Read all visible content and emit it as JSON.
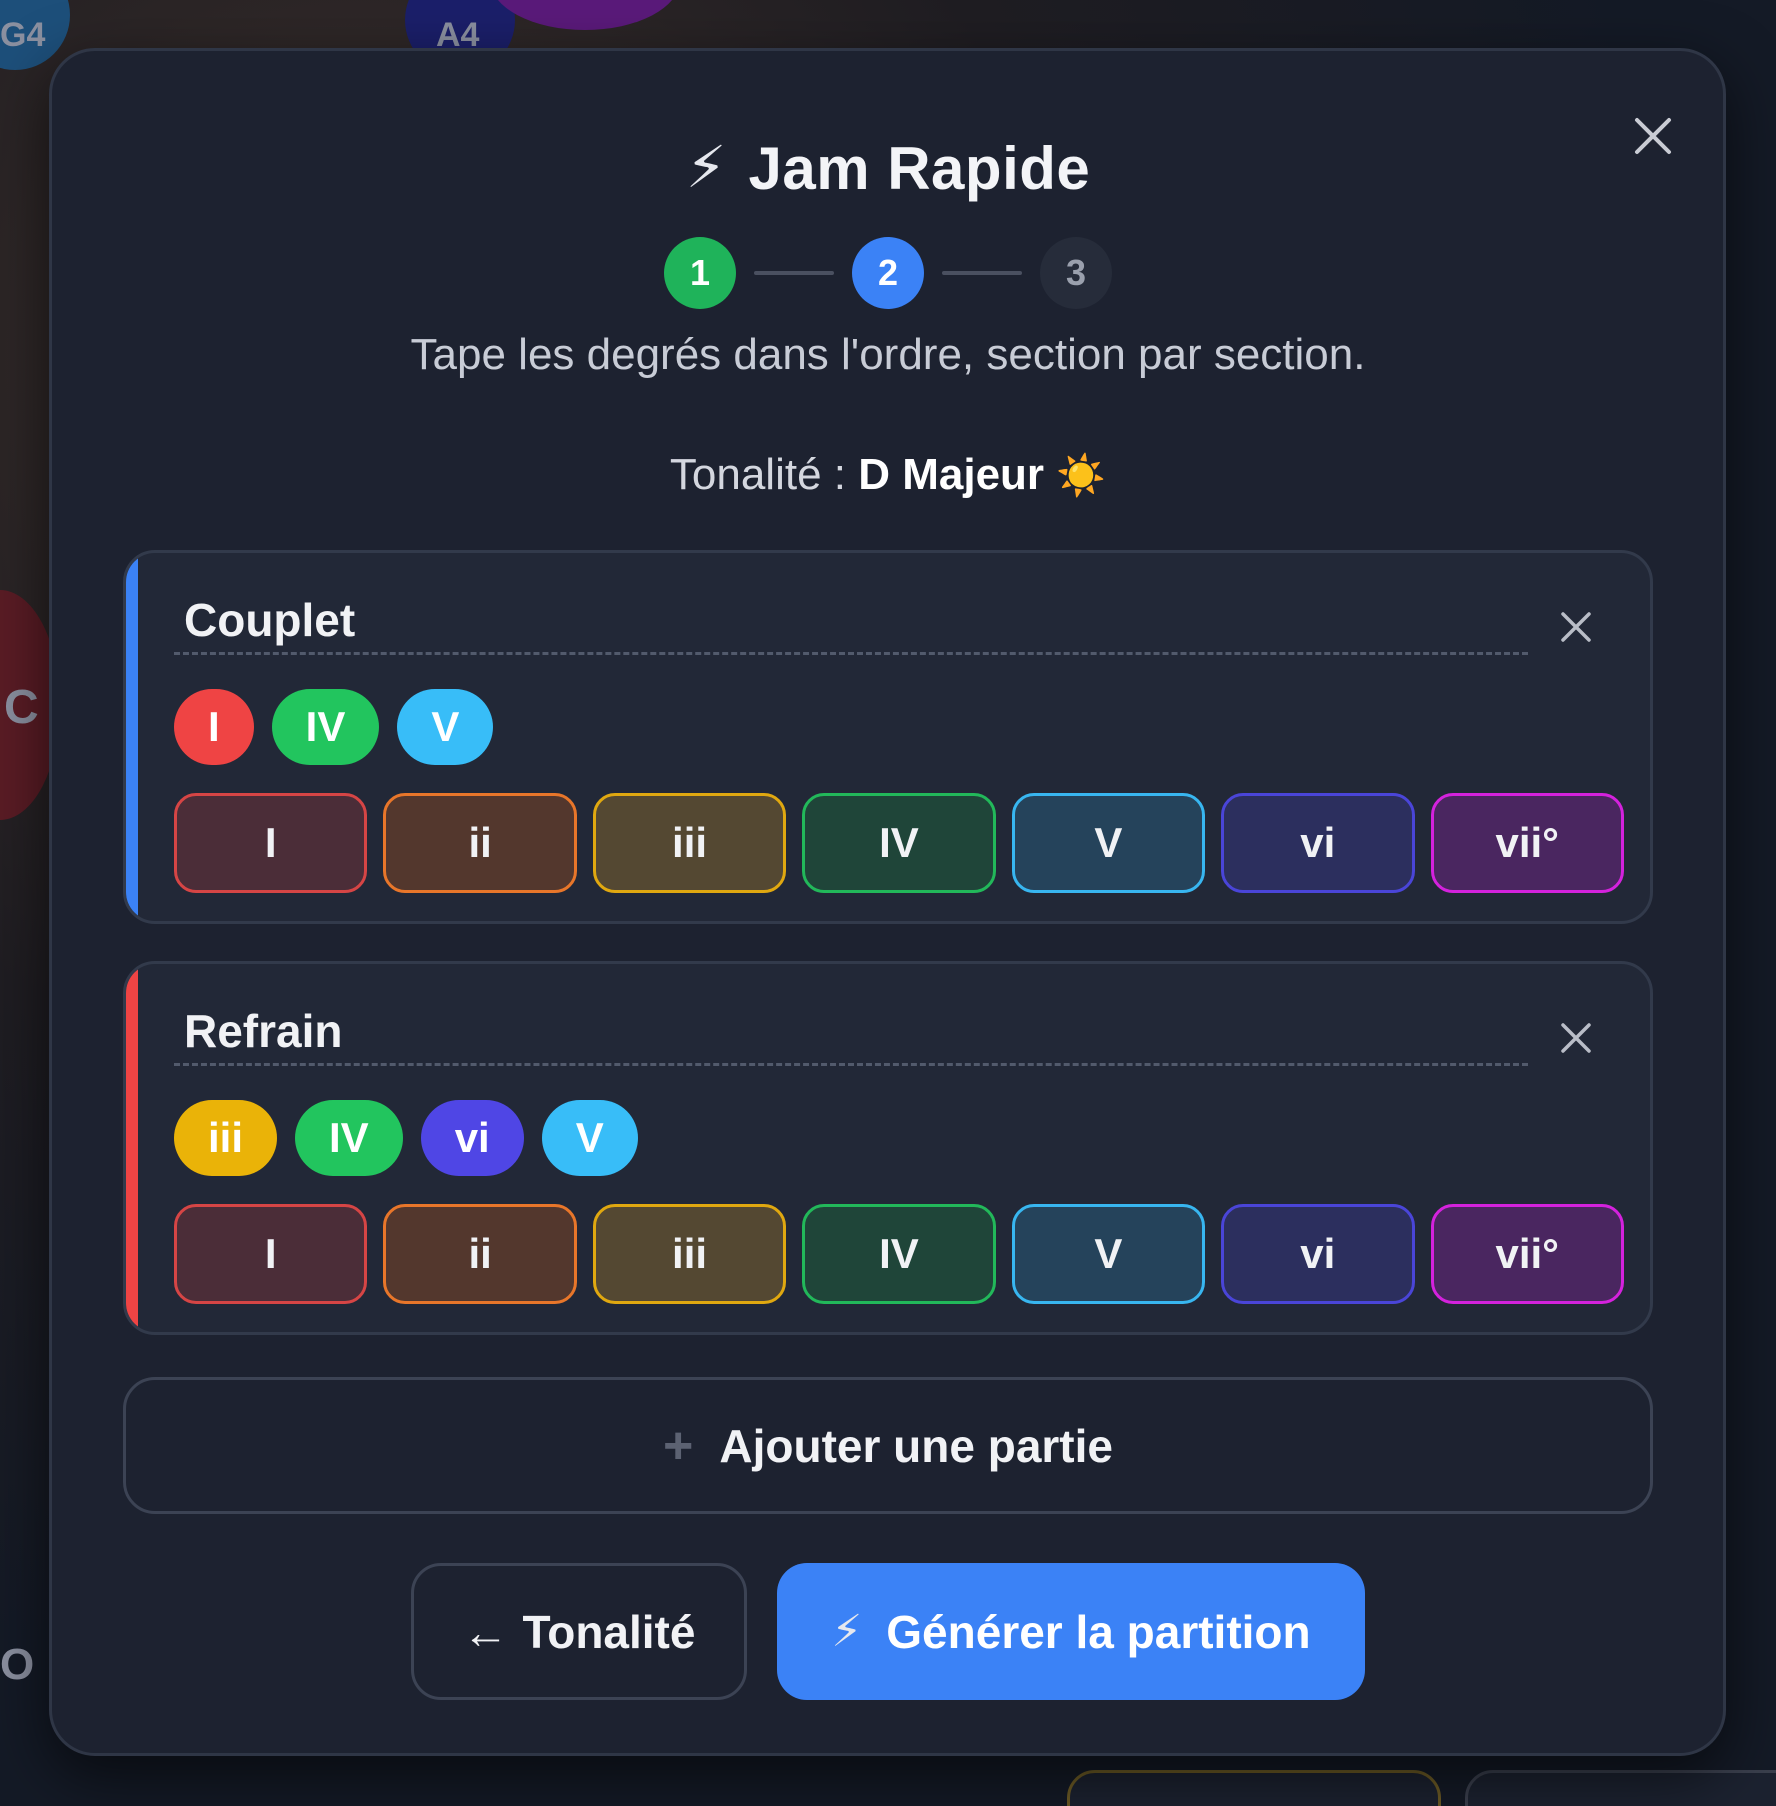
{
  "background": {
    "notes": [
      "G4",
      "A4",
      "C",
      "O"
    ]
  },
  "modal": {
    "title_icon": "⚡",
    "title": "Jam Rapide",
    "steps": [
      {
        "label": "1",
        "state": "done"
      },
      {
        "label": "2",
        "state": "active"
      },
      {
        "label": "3",
        "state": "todo"
      }
    ],
    "subtitle": "Tape les degrés dans l'ordre, section par section.",
    "key_label": "Tonalité : ",
    "key_value": "D Majeur",
    "key_icon": "☀️"
  },
  "degree_buttons": [
    "I",
    "ii",
    "iii",
    "IV",
    "V",
    "vi",
    "vii°"
  ],
  "sections": [
    {
      "title": "Couplet",
      "accent": "#3b82f6",
      "chips": [
        "I",
        "IV",
        "V"
      ]
    },
    {
      "title": "Refrain",
      "accent": "#ef4444",
      "chips": [
        "iii",
        "IV",
        "vi",
        "V"
      ]
    }
  ],
  "colors": {
    "I": {
      "chip": "#ef4444",
      "fill": "#4b2d38",
      "border": "#d64545"
    },
    "ii": {
      "chip": "#f97316",
      "fill": "#53372d",
      "border": "#e8762a"
    },
    "iii": {
      "chip": "#eab308",
      "fill": "#544832",
      "border": "#e0a810"
    },
    "IV": {
      "chip": "#22c55e",
      "fill": "#1f4539",
      "border": "#22b85a"
    },
    "V": {
      "chip": "#38bdf8",
      "fill": "#25435b",
      "border": "#38b6f0"
    },
    "vi": {
      "chip": "#4f46e5",
      "fill": "#2c2f5e",
      "border": "#4a45d8"
    },
    "vii°": {
      "chip": "#c026d3",
      "fill": "#4a2660",
      "border": "#d422dd"
    }
  },
  "add_part_label": "Ajouter une partie",
  "add_part_icon": "+",
  "back_button": {
    "arrow": "←",
    "label": "Tonalité"
  },
  "generate_button": {
    "icon": "⚡",
    "label": "Générer la partition"
  }
}
